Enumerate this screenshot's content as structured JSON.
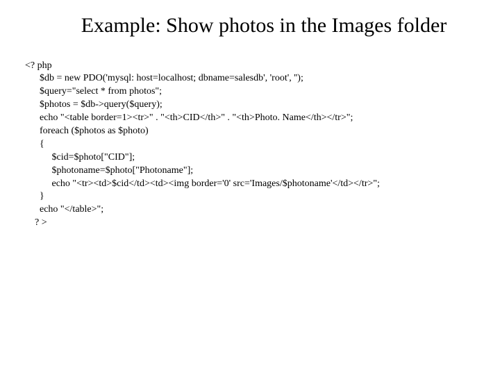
{
  "title": "Example: Show photos in the Images folder",
  "code": {
    "l0": "<? php",
    "l1": "      $db = new PDO('mysql: host=localhost; dbname=salesdb', 'root', '');",
    "l2": "      $query=\"select * from photos\";",
    "l3": "      $photos = $db->query($query);",
    "l4": "      echo \"<table border=1><tr>\" . \"<th>CID</th>\" . \"<th>Photo. Name</th></tr>\";",
    "l5": "      foreach ($photos as $photo)",
    "l6": "      {",
    "l7": "           $cid=$photo[\"CID\"];",
    "l8": "           $photoname=$photo[\"Photoname\"];",
    "l9": "           echo \"<tr><td>$cid</td><td><img border='0' src='Images/$photoname'</td></tr>\";",
    "l10": "      }",
    "l11": "      echo \"</table>\";",
    "l12": "    ? >"
  }
}
